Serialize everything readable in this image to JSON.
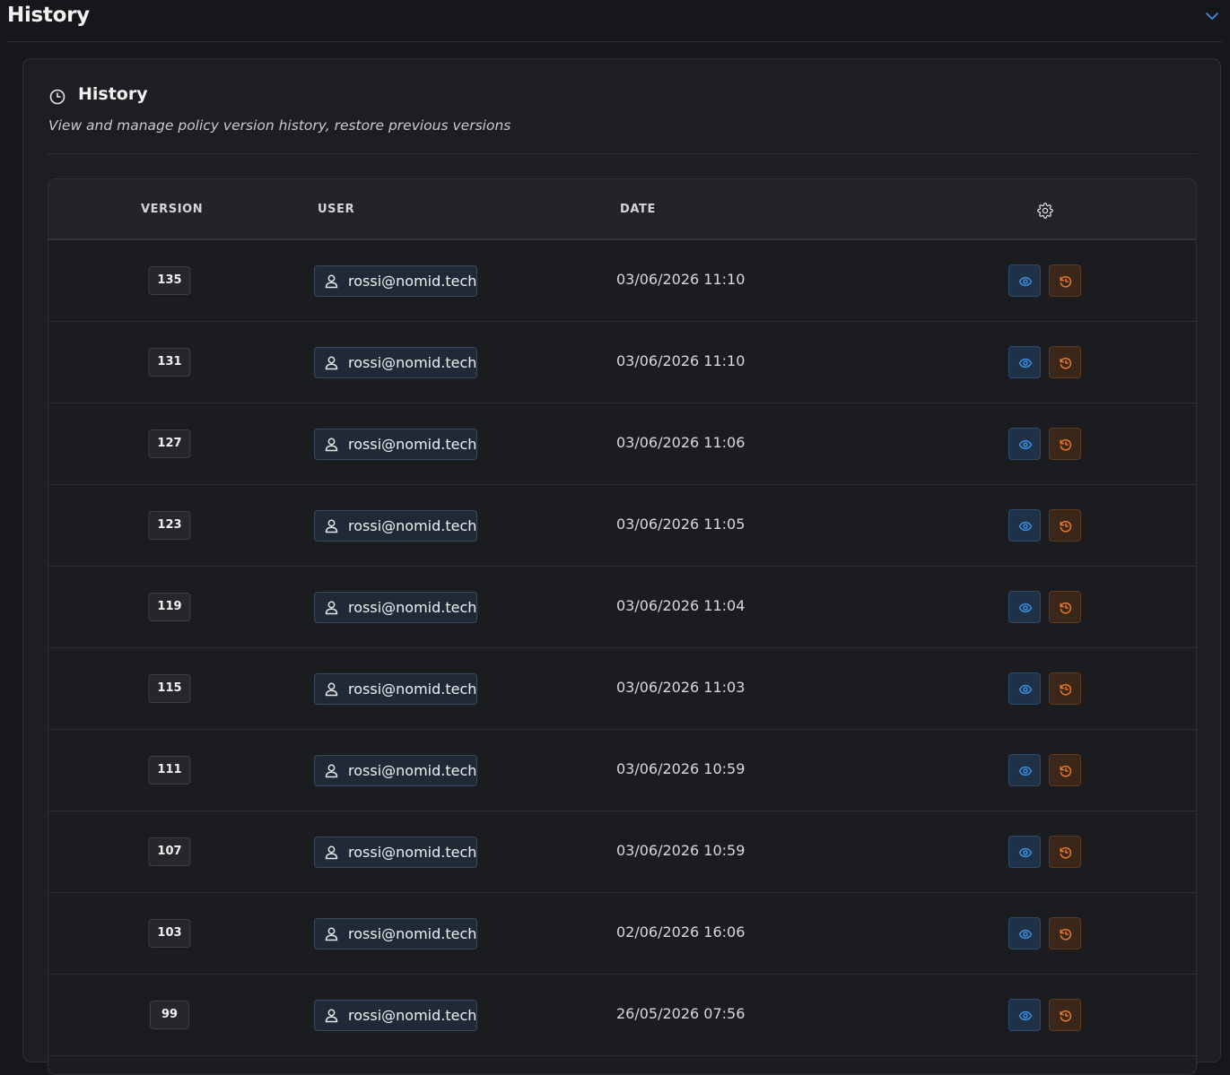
{
  "page": {
    "title": "History"
  },
  "card": {
    "title": "History",
    "subtitle": "View and manage policy version history, restore previous versions"
  },
  "table": {
    "columns": {
      "version": "VERSION",
      "user": "USER",
      "date": "DATE"
    },
    "rows": [
      {
        "version": "135",
        "user": "rossi@nomid.tech",
        "date": "03/06/2026 11:10"
      },
      {
        "version": "131",
        "user": "rossi@nomid.tech",
        "date": "03/06/2026 11:10"
      },
      {
        "version": "127",
        "user": "rossi@nomid.tech",
        "date": "03/06/2026 11:06"
      },
      {
        "version": "123",
        "user": "rossi@nomid.tech",
        "date": "03/06/2026 11:05"
      },
      {
        "version": "119",
        "user": "rossi@nomid.tech",
        "date": "03/06/2026 11:04"
      },
      {
        "version": "115",
        "user": "rossi@nomid.tech",
        "date": "03/06/2026 11:03"
      },
      {
        "version": "111",
        "user": "rossi@nomid.tech",
        "date": "03/06/2026 10:59"
      },
      {
        "version": "107",
        "user": "rossi@nomid.tech",
        "date": "03/06/2026 10:59"
      },
      {
        "version": "103",
        "user": "rossi@nomid.tech",
        "date": "02/06/2026 16:06"
      },
      {
        "version": "99",
        "user": "rossi@nomid.tech",
        "date": "26/05/2026 07:56"
      }
    ]
  },
  "icons": {
    "collapse": "chevron-down-icon",
    "header": "clock-icon",
    "settings": "gear-icon",
    "user": "user-icon",
    "view": "eye-icon",
    "restore": "restore-icon"
  },
  "colors": {
    "accent_blue": "#3b8fe0",
    "accent_orange": "#e8782e"
  }
}
